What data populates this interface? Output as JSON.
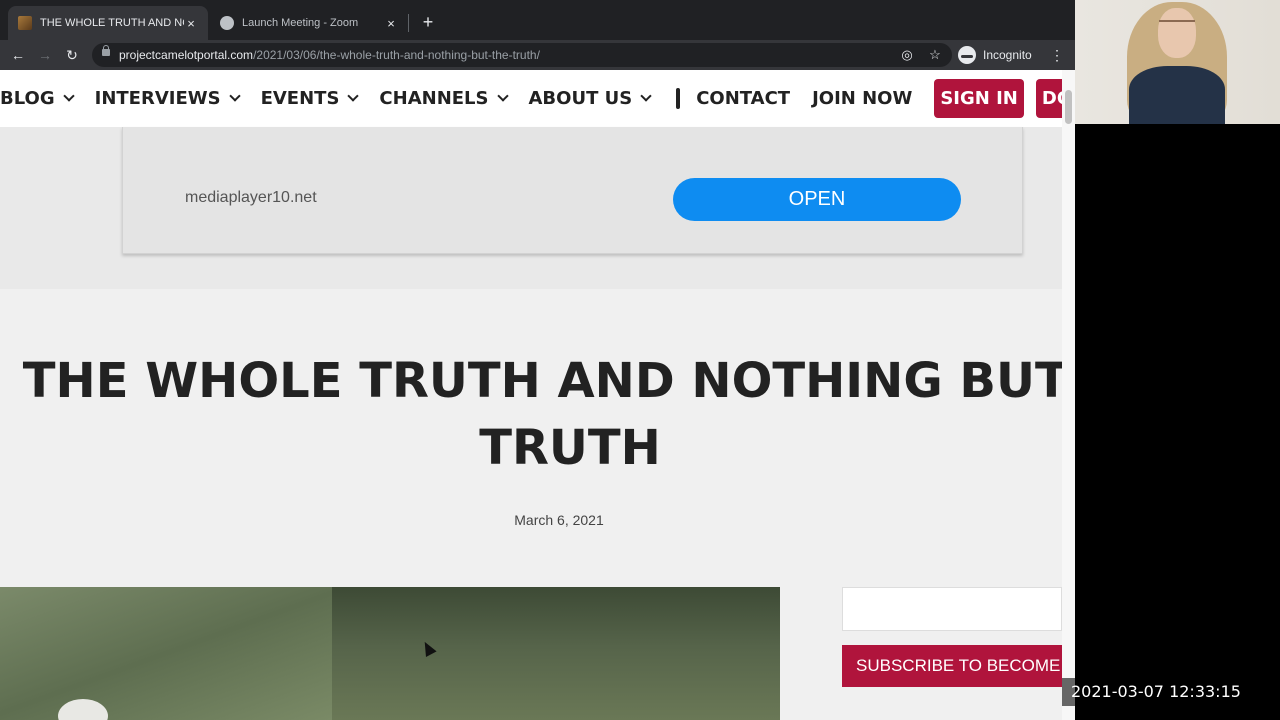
{
  "browser": {
    "tabs": [
      {
        "title": "THE WHOLE TRUTH AND NOTHING BUT THE TRUTH",
        "active": true,
        "close": "×"
      },
      {
        "title": "Launch Meeting - Zoom",
        "active": false,
        "close": "×"
      }
    ],
    "new_tab": "+",
    "back": "←",
    "forward": "→",
    "reload": "↻",
    "url_host": "projectcamelotportal.com",
    "url_path": "/2021/03/06/the-whole-truth-and-nothing-but-the-truth/",
    "profile_label": "Incognito",
    "menu": "⋮",
    "star": "☆",
    "eye_off": "◎"
  },
  "site_nav": {
    "items": [
      {
        "label": "BLOG",
        "dropdown": true
      },
      {
        "label": "INTERVIEWS",
        "dropdown": true
      },
      {
        "label": "EVENTS",
        "dropdown": true
      },
      {
        "label": "CHANNELS",
        "dropdown": true
      },
      {
        "label": "ABOUT US",
        "dropdown": true
      }
    ],
    "contact": "CONTACT",
    "join": "JOIN NOW",
    "sign_in": "SIGN IN",
    "donate": "DONAT"
  },
  "ad": {
    "domain": "mediaplayer10.net",
    "button": "OPEN",
    "button_color": "#0e8cf1"
  },
  "post": {
    "title_line1": "THE WHOLE TRUTH AND NOTHING BUT T",
    "title_line2": "TRUTH",
    "date": "March 6, 2021"
  },
  "sidebar": {
    "subscribe": "SUBSCRIBE TO BECOME A"
  },
  "overlay": {
    "timestamp": "2021-03-07  12:33:15"
  },
  "colors": {
    "accent_red": "#b0143c",
    "chrome_dark": "#202124",
    "chrome_toolbar": "#35363a"
  }
}
